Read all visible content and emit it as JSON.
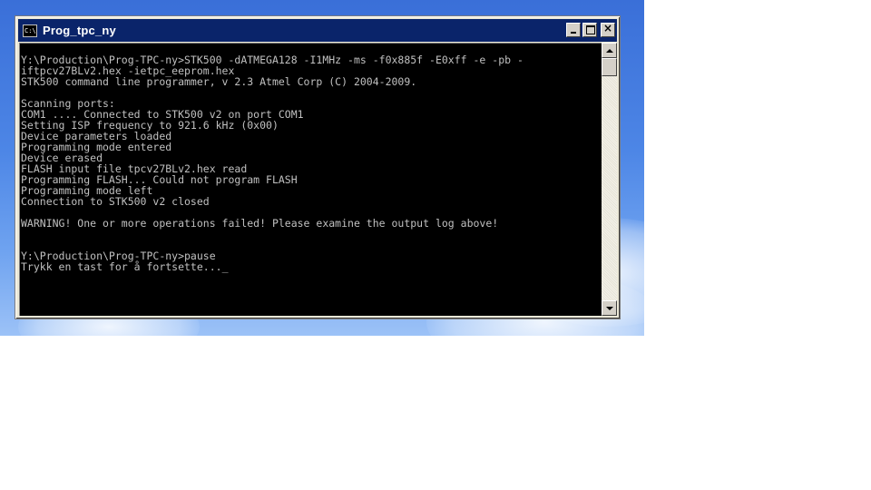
{
  "window": {
    "title": "Prog_tpc_ny",
    "icon_label": "C:\\",
    "icon": "console-icon"
  },
  "controls": {
    "minimize_icon": "minimize-icon",
    "maximize_icon": "maximize-icon",
    "close_glyph": "×"
  },
  "console": {
    "lines": [
      "Y:\\Production\\Prog-TPC-ny>STK500 -dATMEGA128 -I1MHz -ms -f0x885f -E0xff -e -pb -",
      "iftpcv27BLv2.hex -ietpc_eeprom.hex",
      "STK500 command line programmer, v 2.3 Atmel Corp (C) 2004-2009.",
      "",
      "Scanning ports:",
      "COM1 .... Connected to STK500 v2 on port COM1",
      "Setting ISP frequency to 921.6 kHz (0x00)",
      "Device parameters loaded",
      "Programming mode entered",
      "Device erased",
      "FLASH input file tpcv27BLv2.hex read",
      "Programming FLASH... Could not program FLASH",
      "Programming mode left",
      "Connection to STK500 v2 closed",
      "",
      "WARNING! One or more operations failed! Please examine the output log above!",
      "",
      "",
      "Y:\\Production\\Prog-TPC-ny>pause",
      "Trykk en tast for å fortsette..."
    ],
    "cursor": "_"
  }
}
